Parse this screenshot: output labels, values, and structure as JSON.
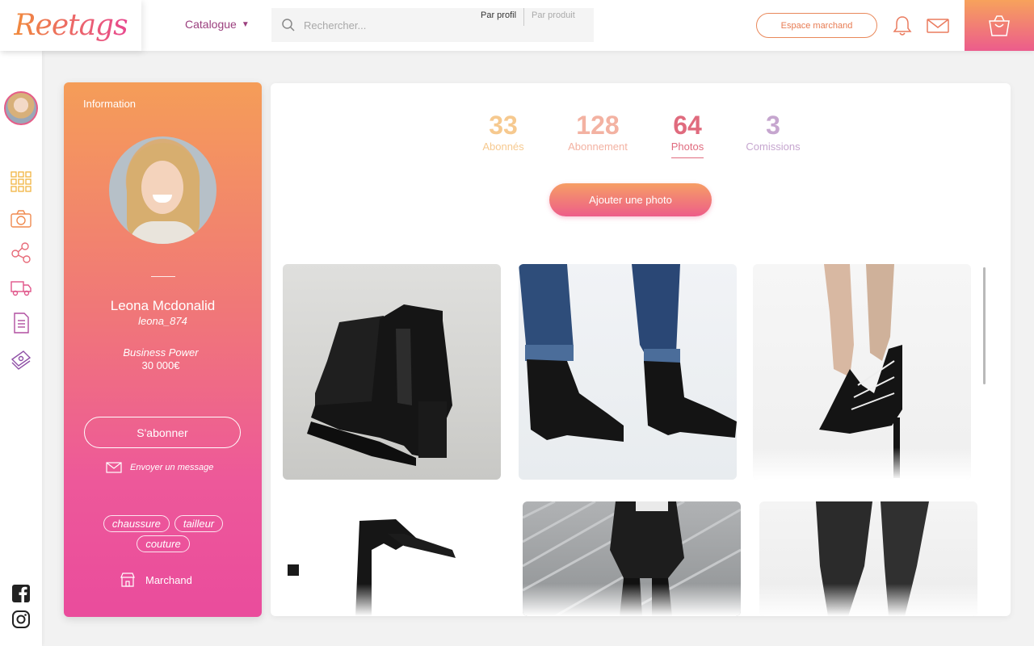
{
  "header": {
    "logo": "Reetags",
    "catalogue_label": "Catalogue",
    "search_placeholder": "Rechercher...",
    "search_modes": [
      "Par profil",
      "Par produit"
    ],
    "merchant_space_label": "Espace marchand"
  },
  "profile": {
    "section_label": "Information",
    "name": "Leona Mcdonalid",
    "handle": "leona_874",
    "business_power_label": "Business Power",
    "business_power_value": "30 000€",
    "subscribe_label": "S'abonner",
    "message_label": "Envoyer un message",
    "tags": [
      "chaussure",
      "tailleur",
      "couture"
    ],
    "merchant_label": "Marchand"
  },
  "stats": [
    {
      "value": "33",
      "label": "Abonnés"
    },
    {
      "value": "128",
      "label": "Abonnement"
    },
    {
      "value": "64",
      "label": "Photos"
    },
    {
      "value": "3",
      "label": "Comissions"
    }
  ],
  "add_photo_label": "Ajouter une photo",
  "colors": {
    "gradient_start": "#f59d58",
    "gradient_end": "#ea4c9c",
    "accent_pink": "#e06b7e",
    "catalogue_purple": "#9b3f7e"
  },
  "rail_icons": [
    "grid-icon",
    "camera-icon",
    "share-icon",
    "truck-icon",
    "document-icon",
    "cash-icon"
  ],
  "social_icons": [
    "facebook-icon",
    "instagram-icon"
  ]
}
